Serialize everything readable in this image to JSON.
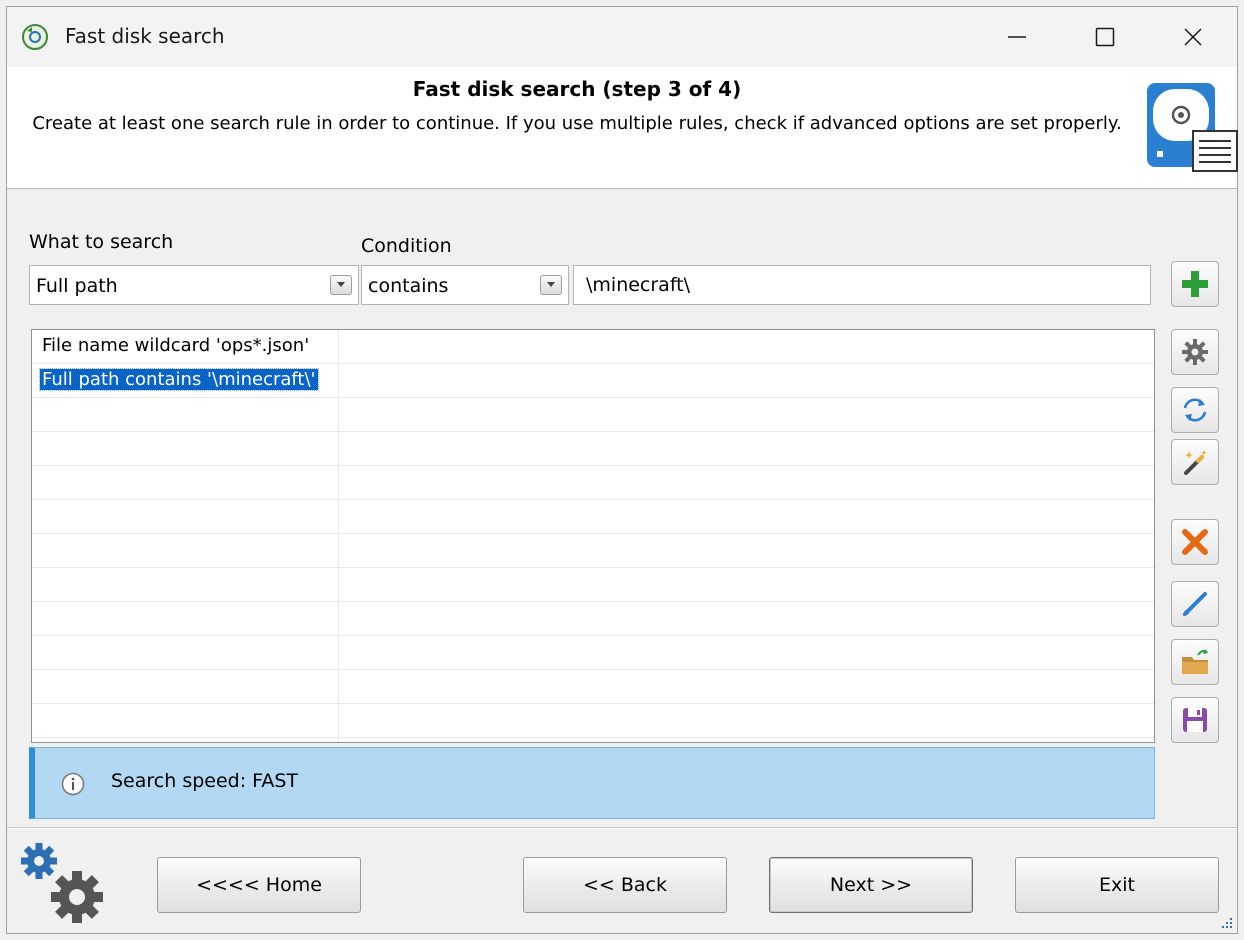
{
  "window": {
    "title": "Fast disk search"
  },
  "header": {
    "step_title": "Fast disk search (step 3 of 4)",
    "description": "Create at least one search rule in order to continue. If you use multiple rules, check if advanced options are set properly."
  },
  "form": {
    "what_label": "What to search",
    "what_value": "Full path",
    "condition_label": "Condition",
    "condition_value": "contains",
    "search_value": "\\minecraft\\"
  },
  "rules": [
    {
      "text": "File name wildcard 'ops*.json'",
      "selected": false
    },
    {
      "text": "Full path contains '\\minecraft\\'",
      "selected": true
    }
  ],
  "side_buttons": [
    "add-icon",
    "gear-icon",
    "refresh-icon",
    "magic-wand-icon",
    "delete-icon",
    "edit-icon",
    "open-folder-icon",
    "save-icon"
  ],
  "info": {
    "text": "Search speed: FAST"
  },
  "buttons": {
    "home": "<<<< Home",
    "back": "<< Back",
    "next": "Next >>",
    "exit": "Exit"
  },
  "colors": {
    "selection": "#0a64c8",
    "info_bg": "#b3d8f3",
    "info_accent": "#2f8fdc",
    "add_green": "#2e9e3a",
    "delete_orange": "#e36a12"
  }
}
